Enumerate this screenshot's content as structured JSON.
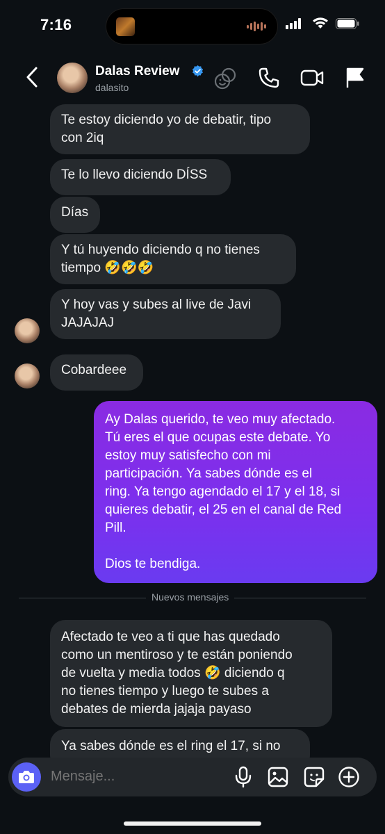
{
  "status": {
    "time": "7:16"
  },
  "header": {
    "back_icon": "chevron-left-icon",
    "name": "Dalas Review",
    "username": "dalasito",
    "verified": true,
    "actions": [
      "effects-icon",
      "phone-icon",
      "video-icon",
      "flag-icon"
    ]
  },
  "messages": [
    {
      "from": "them",
      "text": "Te estoy diciendo yo de debatir, tipo\ncon 2iq"
    },
    {
      "from": "them",
      "text": "Te lo llevo diciendo DÍSS"
    },
    {
      "from": "them",
      "text": "Días"
    },
    {
      "from": "them",
      "text": "Y tú huyendo diciendo q no tienes\ntiempo 🤣🤣🤣"
    },
    {
      "from": "them",
      "text": "Y hoy vas y subes al live de Javi\nJAJAJAJ"
    },
    {
      "from": "them",
      "text": "Cobardeee"
    },
    {
      "from": "me",
      "text": "Ay Dalas querido, te veo muy afectado.\nTú eres el que ocupas este debate. Yo\nestoy muy satisfecho con mi\nparticipación. Ya sabes dónde es el\nring. Ya tengo agendado el 17 y el 18, si\nquieres debatir, el 25 en el canal de Red\nPill.\n\nDios te bendiga."
    },
    {
      "from": "them",
      "text": "Afectado te veo a ti que has quedado\ncomo un mentiroso y te están poniendo\nde vuelta y media todos 🤣 diciendo q\nno tienes tiempo y luego te subes a\ndebates de mierda jajaja payaso"
    },
    {
      "from": "them",
      "text": "Ya sabes dónde es el ring el 17, si no"
    }
  ],
  "divider": {
    "label": "Nuevos mensajes"
  },
  "composer": {
    "placeholder": "Mensaje...",
    "icons": [
      "camera-icon",
      "microphone-icon",
      "image-icon",
      "sticker-icon",
      "plus-icon"
    ]
  },
  "colors": {
    "background": "#0c1014",
    "incoming": "#262a2e",
    "outgoing": "#7b30ee",
    "accent": "#5b61f5",
    "verified": "#3797f0"
  }
}
